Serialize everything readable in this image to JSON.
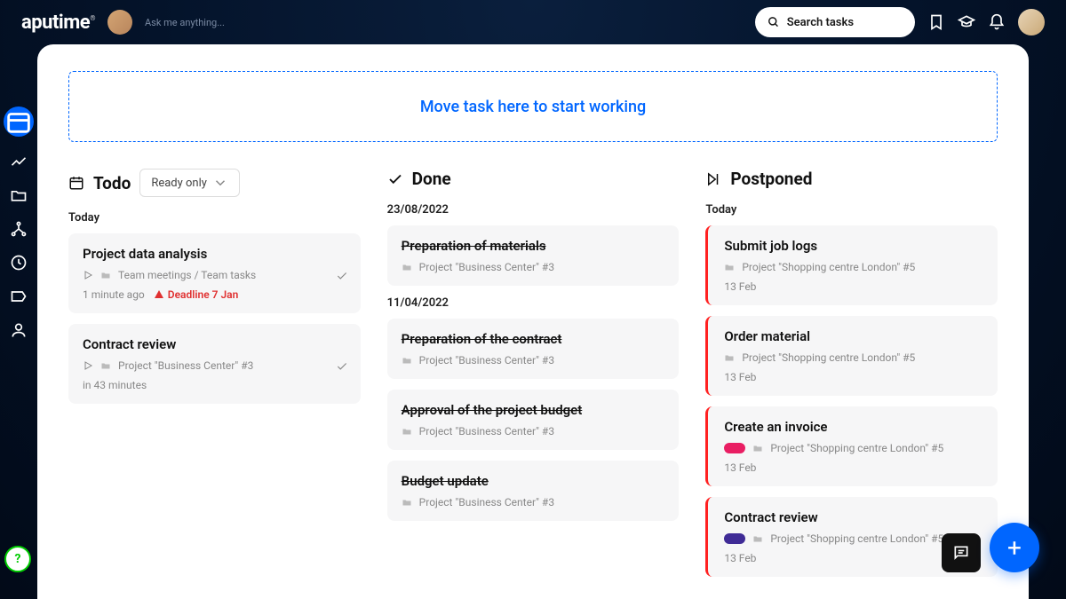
{
  "header": {
    "logo": "aputime",
    "ask_placeholder": "Ask me anything...",
    "search_placeholder": "Search tasks"
  },
  "dropzone": "Move task here to start working",
  "columns": {
    "todo": {
      "title": "Todo",
      "filter": "Ready only"
    },
    "done": {
      "title": "Done"
    },
    "postponed": {
      "title": "Postponed"
    }
  },
  "todo_section": "Today",
  "todo": [
    {
      "title": "Project data analysis",
      "folder": "Team meetings / Team tasks",
      "time": "1 minute ago",
      "deadline": "Deadline 7 Jan"
    },
    {
      "title": "Contract review",
      "folder": "Project \"Business Center\" #3",
      "time": "in 43 minutes"
    }
  ],
  "done_groups": [
    {
      "date": "23/08/2022",
      "tasks": [
        {
          "title": "Preparation of materials",
          "folder": "Project \"Business Center\" #3"
        }
      ]
    },
    {
      "date": "11/04/2022",
      "tasks": [
        {
          "title": "Preparation of the contract",
          "folder": "Project \"Business Center\" #3"
        },
        {
          "title": "Approval of the project budget",
          "folder": "Project \"Business Center\" #3"
        },
        {
          "title": "Budget update",
          "folder": "Project \"Business Center\" #3"
        }
      ]
    }
  ],
  "postponed_section": "Today",
  "postponed": [
    {
      "title": "Submit job logs",
      "folder": "Project \"Shopping centre London\" #5",
      "date": "13 Feb",
      "pill": null
    },
    {
      "title": "Order material",
      "folder": "Project \"Shopping centre London\" #5",
      "date": "13 Feb",
      "pill": null
    },
    {
      "title": "Create an invoice",
      "folder": "Project \"Shopping centre London\" #5",
      "date": "13 Feb",
      "pill": "pink"
    },
    {
      "title": "Contract review",
      "folder": "Project \"Shopping centre London\" #5",
      "date": "13 Feb",
      "pill": "purple"
    }
  ]
}
